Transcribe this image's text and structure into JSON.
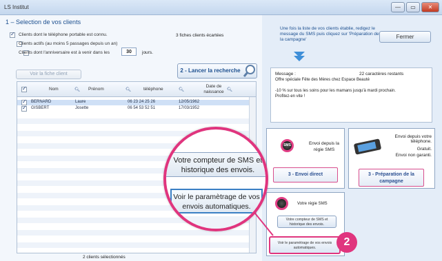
{
  "window": {
    "title": "LS Institut",
    "controls": [
      "—",
      "▭",
      "✕"
    ]
  },
  "section": {
    "title": "1 – Selection de vos clients"
  },
  "filters": {
    "mobile": "Clients dont le téléphone portable est connu.",
    "active": "Clients actifs  (au moins 5 passages depuis un an)",
    "birthday_prefix": "Clients dont l'anniversaire est à venir dans les",
    "birthday_days": "30",
    "birthday_suffix": "jours.",
    "excluded": "3 fiches clients écartées"
  },
  "buttons": {
    "view_client": "Voir la fiche client",
    "search": "2 - Lancer la recherche",
    "close": "Fermer",
    "direct_send": "3 - Envoi direct",
    "campaign": "3 - Préparation de la campagne",
    "counter": "Votre compteur de SMS et historique des envois.",
    "settings": "Voir le paramètrage de vos envois automatiques."
  },
  "grid": {
    "columns": [
      "Nom",
      "Prénom",
      "téléphone",
      "Date de naissance"
    ],
    "rows": [
      {
        "nom": "BERNARD",
        "prenom": "Laure",
        "tel": "06 23 24 25 26",
        "date": "12/05/1962"
      },
      {
        "nom": "GISBERT",
        "prenom": "Josette",
        "tel": "06 54 53 52 51",
        "date": "17/03/1952"
      }
    ],
    "footer": "2 clients sélectionnés"
  },
  "instructions": "Une fois la liste de vos clients établie, redigez le message du SMS puis cliquez sur 'Préparation de la campagne'",
  "message": {
    "label": "Message :",
    "remaining": "22 caractères restants",
    "line1": "Offre spéciale Fête des Mères chez Espace Beauté",
    "line2": "-10 % sur tous les soins pour les mamans jusqu'à mardi prochain.",
    "line3": "Profitez-en vite !"
  },
  "cards": {
    "direct_text": "Envoi depuis la régie SMS",
    "phone_text_1": "Envoi depuis votre téléphone.",
    "phone_text_2": "Gratuit.",
    "phone_text_3": "Envoi non garanti.",
    "regie_label": "Votre régie SMS",
    "sms_icon": "SMS"
  },
  "zoom": {
    "counter": "Votre compteur de SMS et historique des envois.",
    "settings": "Voir le paramètrage de vos envois automatiques."
  },
  "badge": "2",
  "colors": {
    "accent": "#e0357e",
    "title_blue": "#1c4f8f",
    "selection": "#cfe0f6"
  }
}
